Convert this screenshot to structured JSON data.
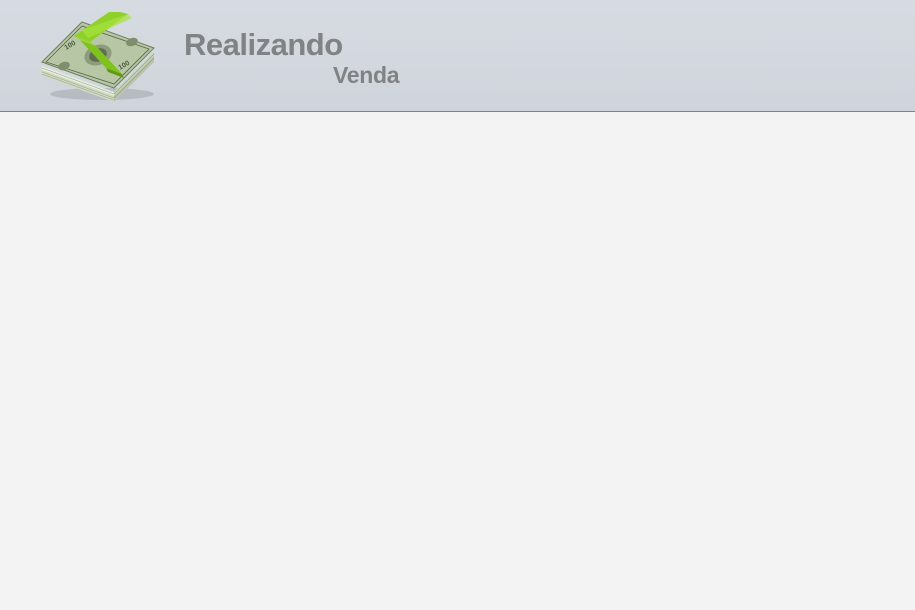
{
  "header": {
    "title": "Realizando",
    "subtitle": "Venda",
    "logo_icon": "money-stack-icon"
  },
  "colors": {
    "header_bg": "#d4d9e0",
    "header_border": "#7f8388",
    "title_text": "#808284",
    "content_bg": "#f3f3f3",
    "band_green": "#8fd12a"
  }
}
